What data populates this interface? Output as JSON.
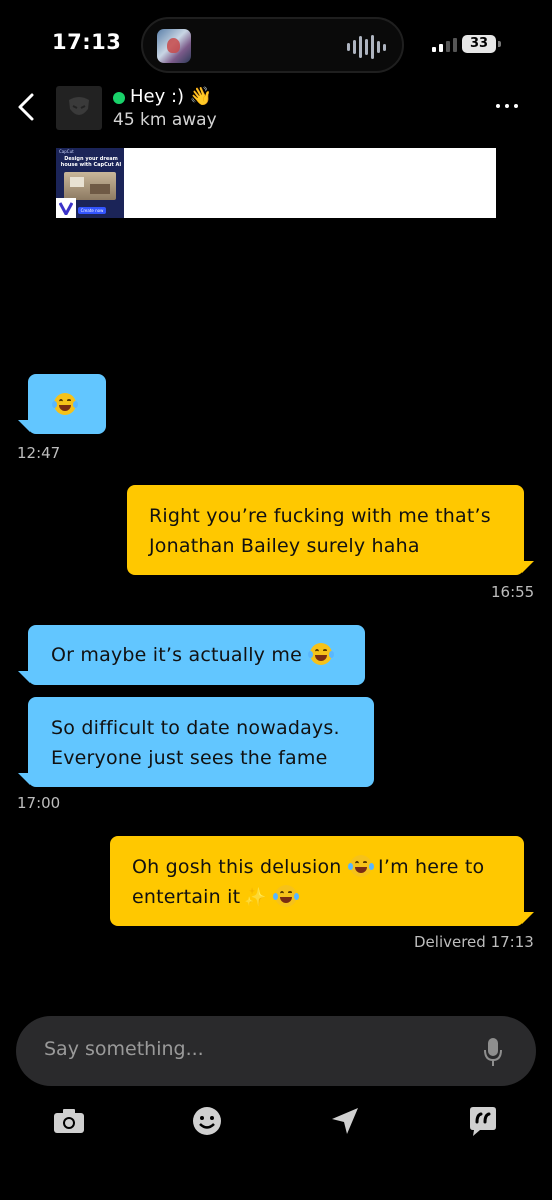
{
  "status_bar": {
    "time": "17:13",
    "battery": "33"
  },
  "header": {
    "contact_status": "Hey :) 👋",
    "distance": "45 km away",
    "online_color": "#19d26a"
  },
  "ad": {
    "brand": "CapCut",
    "headline": "Design your dream house with CapCut AI",
    "cta": "Create now"
  },
  "messages": [
    {
      "direction": "in",
      "text": "",
      "emoji": "laughing-tears",
      "time": "12:47"
    },
    {
      "direction": "out",
      "text": "Right you’re fucking with me that’s\nJonathan Bailey surely haha",
      "time": "16:55"
    },
    {
      "direction": "in",
      "text": "Or maybe it’s actually me",
      "emoji": "laughing-tears"
    },
    {
      "direction": "in",
      "text": "So difficult to date nowadays.\nEveryone just sees the fame",
      "time": "17:00"
    },
    {
      "direction": "out",
      "text_line1": "Oh gosh this delusion",
      "text_line1b": "I’m here to",
      "text_line2": "entertain it",
      "status": "Delivered 17:13"
    }
  ],
  "input": {
    "placeholder": "Say something..."
  },
  "toolbar": {
    "items": [
      "camera-icon",
      "emoji-icon",
      "location-icon",
      "saved-phrases-icon"
    ]
  },
  "colors": {
    "incoming_bubble": "#62c6ff",
    "outgoing_bubble": "#ffc800",
    "background": "#000000"
  }
}
